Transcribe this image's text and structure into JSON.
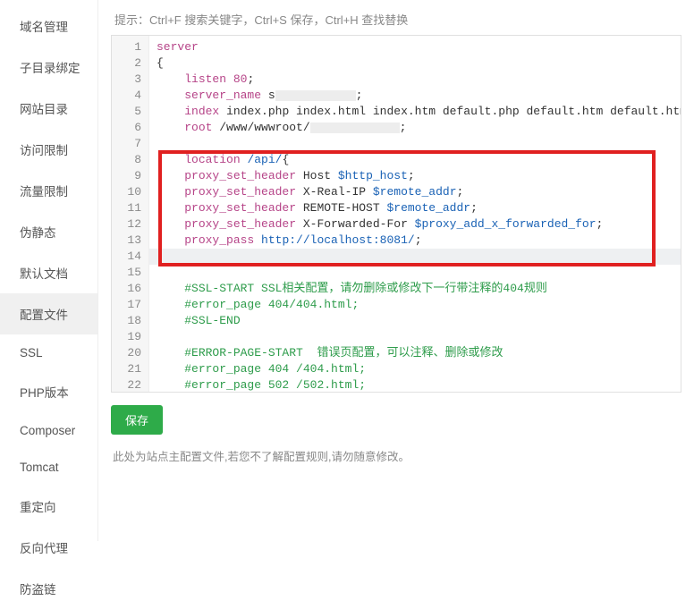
{
  "hint": "提示：Ctrl+F 搜索关键字，Ctrl+S 保存，Ctrl+H 查找替换",
  "sidebar": {
    "items": [
      {
        "label": "域名管理",
        "active": false
      },
      {
        "label": "子目录绑定",
        "active": false
      },
      {
        "label": "网站目录",
        "active": false
      },
      {
        "label": "访问限制",
        "active": false
      },
      {
        "label": "流量限制",
        "active": false
      },
      {
        "label": "伪静态",
        "active": false
      },
      {
        "label": "默认文档",
        "active": false
      },
      {
        "label": "配置文件",
        "active": true
      },
      {
        "label": "SSL",
        "active": false
      },
      {
        "label": "PHP版本",
        "active": false
      },
      {
        "label": "Composer",
        "active": false
      },
      {
        "label": "Tomcat",
        "active": false
      },
      {
        "label": "重定向",
        "active": false
      },
      {
        "label": "反向代理",
        "active": false
      },
      {
        "label": "防盗链",
        "active": false
      }
    ]
  },
  "editor": {
    "visible_line_start": 1,
    "visible_line_end": 22,
    "highlight_line": 14,
    "red_box_lines": [
      8,
      14
    ],
    "lines": [
      {
        "n": 1,
        "tokens": [
          [
            "kw",
            "server"
          ]
        ]
      },
      {
        "n": 2,
        "tokens": [
          [
            "plain",
            "{"
          ]
        ]
      },
      {
        "n": 3,
        "tokens": [
          [
            "plain",
            "    "
          ],
          [
            "key",
            "listen"
          ],
          [
            "plain",
            " "
          ],
          [
            "num",
            "80"
          ],
          [
            "plain",
            ";"
          ]
        ]
      },
      {
        "n": 4,
        "tokens": [
          [
            "plain",
            "    "
          ],
          [
            "key",
            "server_name"
          ],
          [
            "plain",
            " s"
          ],
          [
            "mask",
            90
          ],
          [
            "plain",
            ";"
          ]
        ]
      },
      {
        "n": 5,
        "tokens": [
          [
            "plain",
            "    "
          ],
          [
            "key",
            "index"
          ],
          [
            "plain",
            " index.php index.html index.htm default.php default.htm default.html;"
          ]
        ]
      },
      {
        "n": 6,
        "tokens": [
          [
            "plain",
            "    "
          ],
          [
            "key",
            "root"
          ],
          [
            "plain",
            " /www/wwwroot/"
          ],
          [
            "mask",
            100
          ],
          [
            "plain",
            ";"
          ]
        ]
      },
      {
        "n": 7,
        "tokens": [
          [
            "plain",
            " "
          ]
        ]
      },
      {
        "n": 8,
        "tokens": [
          [
            "plain",
            "    "
          ],
          [
            "key",
            "location"
          ],
          [
            "plain",
            " "
          ],
          [
            "str",
            "/api/"
          ],
          [
            "plain",
            "{"
          ]
        ]
      },
      {
        "n": 9,
        "tokens": [
          [
            "plain",
            "    "
          ],
          [
            "key",
            "proxy_set_header"
          ],
          [
            "plain",
            " Host "
          ],
          [
            "var",
            "$http_host"
          ],
          [
            "plain",
            ";"
          ]
        ]
      },
      {
        "n": 10,
        "tokens": [
          [
            "plain",
            "    "
          ],
          [
            "key",
            "proxy_set_header"
          ],
          [
            "plain",
            " X-Real-IP "
          ],
          [
            "var",
            "$remote_addr"
          ],
          [
            "plain",
            ";"
          ]
        ]
      },
      {
        "n": 11,
        "tokens": [
          [
            "plain",
            "    "
          ],
          [
            "key",
            "proxy_set_header"
          ],
          [
            "plain",
            " REMOTE-HOST "
          ],
          [
            "var",
            "$remote_addr"
          ],
          [
            "plain",
            ";"
          ]
        ]
      },
      {
        "n": 12,
        "tokens": [
          [
            "plain",
            "    "
          ],
          [
            "key",
            "proxy_set_header"
          ],
          [
            "plain",
            " X-Forwarded-For "
          ],
          [
            "var",
            "$proxy_add_x_forwarded_for"
          ],
          [
            "plain",
            ";"
          ]
        ]
      },
      {
        "n": 13,
        "tokens": [
          [
            "plain",
            "    "
          ],
          [
            "key",
            "proxy_pass"
          ],
          [
            "plain",
            " "
          ],
          [
            "str",
            "http://localhost:8081/"
          ],
          [
            "plain",
            ";"
          ]
        ]
      },
      {
        "n": 14,
        "tokens": [
          [
            "plain",
            "    }"
          ],
          [
            "cursor",
            ""
          ]
        ]
      },
      {
        "n": 15,
        "tokens": [
          [
            "plain",
            " "
          ]
        ]
      },
      {
        "n": 16,
        "tokens": [
          [
            "plain",
            "    "
          ],
          [
            "cmt",
            "#SSL-START SSL相关配置，请勿删除或修改下一行带注释的404规则"
          ]
        ]
      },
      {
        "n": 17,
        "tokens": [
          [
            "plain",
            "    "
          ],
          [
            "cmt",
            "#error_page 404/404.html;"
          ]
        ]
      },
      {
        "n": 18,
        "tokens": [
          [
            "plain",
            "    "
          ],
          [
            "cmt",
            "#SSL-END"
          ]
        ]
      },
      {
        "n": 19,
        "tokens": [
          [
            "plain",
            " "
          ]
        ]
      },
      {
        "n": 20,
        "tokens": [
          [
            "plain",
            "    "
          ],
          [
            "cmt",
            "#ERROR-PAGE-START  错误页配置，可以注释、删除或修改"
          ]
        ]
      },
      {
        "n": 21,
        "tokens": [
          [
            "plain",
            "    "
          ],
          [
            "cmt",
            "#error_page 404 /404.html;"
          ]
        ]
      },
      {
        "n": 22,
        "tokens": [
          [
            "plain",
            "    "
          ],
          [
            "cmt",
            "#error_page 502 /502.html;"
          ]
        ]
      }
    ]
  },
  "save_label": "保存",
  "note": "此处为站点主配置文件,若您不了解配置规则,请勿随意修改。"
}
